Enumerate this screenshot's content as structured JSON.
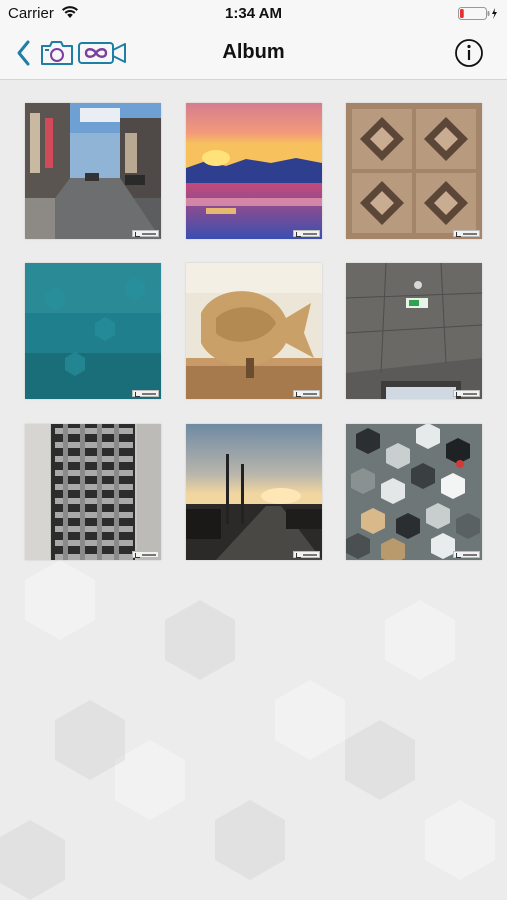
{
  "status_bar": {
    "carrier": "Carrier",
    "time": "1:34 AM",
    "battery_level": 0.15,
    "battery_color": "#e5312f",
    "charging": true
  },
  "nav_bar": {
    "title": "Album",
    "back_icon": "chevron-left-icon",
    "camera_icon": "camera-icon",
    "loop_video_icon": "infinity-video-icon",
    "info_icon": "info-circle-icon",
    "accent_color": "#1e7ea6",
    "secondary_accent": "#7b3fa0"
  },
  "album": {
    "photos": [
      {
        "subject": "street"
      },
      {
        "subject": "sunset-lake"
      },
      {
        "subject": "tiles"
      },
      {
        "subject": "teal-hex"
      },
      {
        "subject": "fish"
      },
      {
        "subject": "ceiling"
      },
      {
        "subject": "grate"
      },
      {
        "subject": "evening-road"
      },
      {
        "subject": "bokeh"
      }
    ]
  }
}
